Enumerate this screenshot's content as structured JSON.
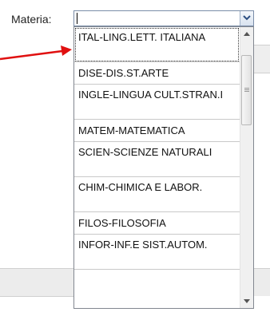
{
  "form": {
    "field_label": "Materia:",
    "selected_value": ""
  },
  "dropdown": {
    "items": [
      {
        "label": "ITAL-LING.LETT. ITALIANA"
      },
      {
        "label": "DISE-DIS.ST.ARTE"
      },
      {
        "label": "INGLE-LINGUA CULT.STRAN.I"
      },
      {
        "label": "MATEM-MATEMATICA"
      },
      {
        "label": "SCIEN-SCIENZE NATURALI"
      },
      {
        "label": "CHIM-CHIMICA E LABOR."
      },
      {
        "label": "FILOS-FILOSOFIA"
      },
      {
        "label": "INFOR-INF.E SIST.AUTOM."
      }
    ]
  },
  "colors": {
    "annotation_arrow": "#e01010",
    "dropdown_border": "#7a8da8",
    "list_border": "#828790",
    "item_divider": "#c9c9c9",
    "scrollbar_track": "#f0f0f0"
  },
  "icons": {
    "dropdown": "chevron-down-icon",
    "scroll_up": "arrow-up-icon",
    "scroll_down": "arrow-down-icon",
    "annotation": "red-arrow-icon"
  }
}
